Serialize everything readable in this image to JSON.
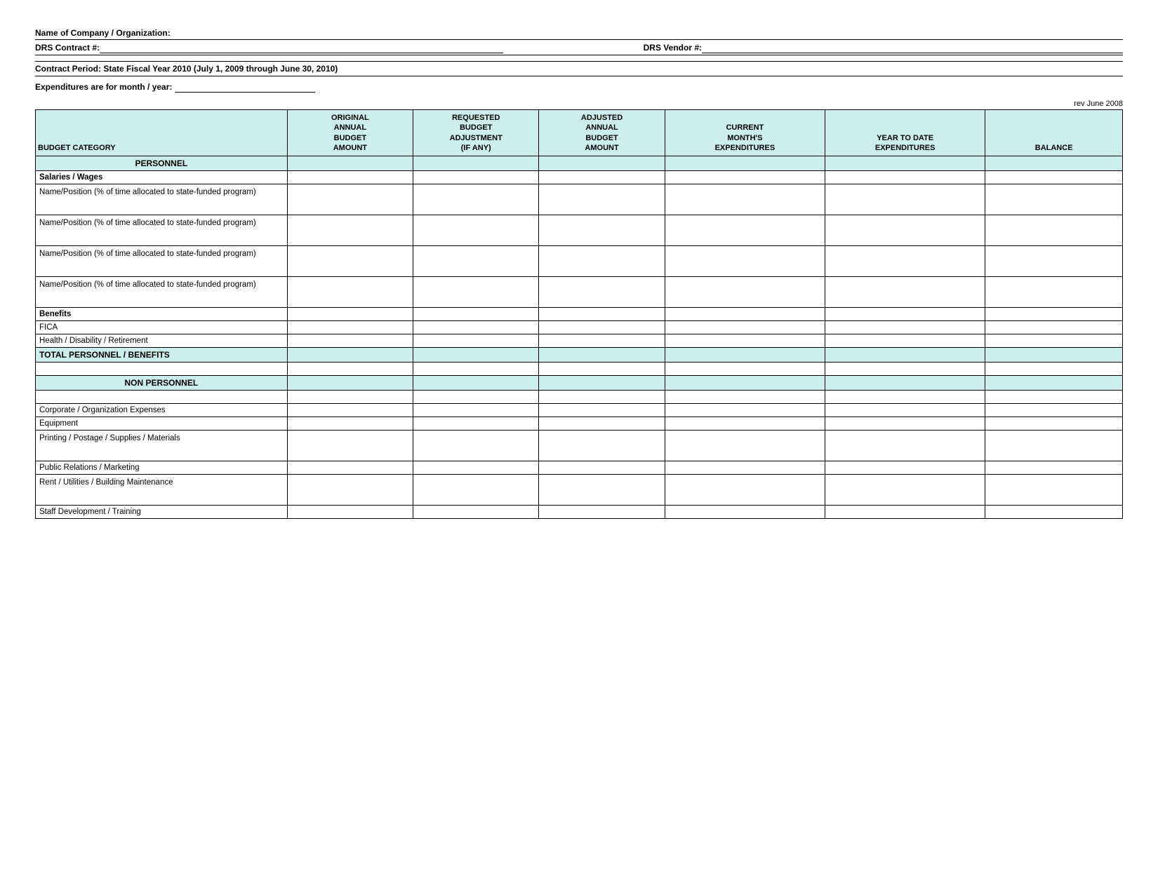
{
  "header": {
    "company_label": "Name of Company / Organization:",
    "contract_label": "DRS Contract #:",
    "vendor_label": "DRS Vendor #:",
    "period_label": "Contract Period: State Fiscal Year 2010 (July 1, 2009 through June 30, 2010)",
    "expenditures_label": "Expenditures are for month / year:",
    "rev_note": "rev June 2008"
  },
  "columns": {
    "budget_category": "BUDGET CATEGORY",
    "original_annual_budget_amount": "ORIGINAL ANNUAL BUDGET AMOUNT",
    "requested_budget_adjustment": "REQUESTED BUDGET ADJUSTMENT (if any)",
    "adjusted_annual_budget_amount": "ADJUSTED ANNUAL BUDGET AMOUNT",
    "current_months_expenditures": "CURRENT MONTH'S EXPENDITURES",
    "year_to_date_expenditures": "YEAR TO DATE EXPENDITURES",
    "balance": "BALANCE"
  },
  "rows": {
    "personnel_header": "PERSONNEL",
    "salaries_wages": "Salaries / Wages",
    "name_position_1": "Name/Position (% of time allocated to state-funded program)",
    "name_position_2": "Name/Position (% of time allocated to state-funded program)",
    "name_position_3": "Name/Position (% of time allocated to state-funded program)",
    "name_position_4": "Name/Position (% of time allocated to state-funded program)",
    "benefits": "Benefits",
    "fica": "FICA",
    "health_disability_retirement": "Health / Disability / Retirement",
    "total_personnel_benefits": "TOTAL PERSONNEL / BENEFITS",
    "non_personnel_header": "NON PERSONNEL",
    "corporate_org_expenses": "Corporate / Organization Expenses",
    "equipment": "Equipment",
    "printing_postage_supplies_materials": "Printing / Postage / Supplies / Materials",
    "public_relations_marketing": "Public Relations / Marketing",
    "rent_utilities_building_maintenance": "Rent / Utilities / Building Maintenance",
    "staff_development_training": "Staff Development / Training"
  }
}
